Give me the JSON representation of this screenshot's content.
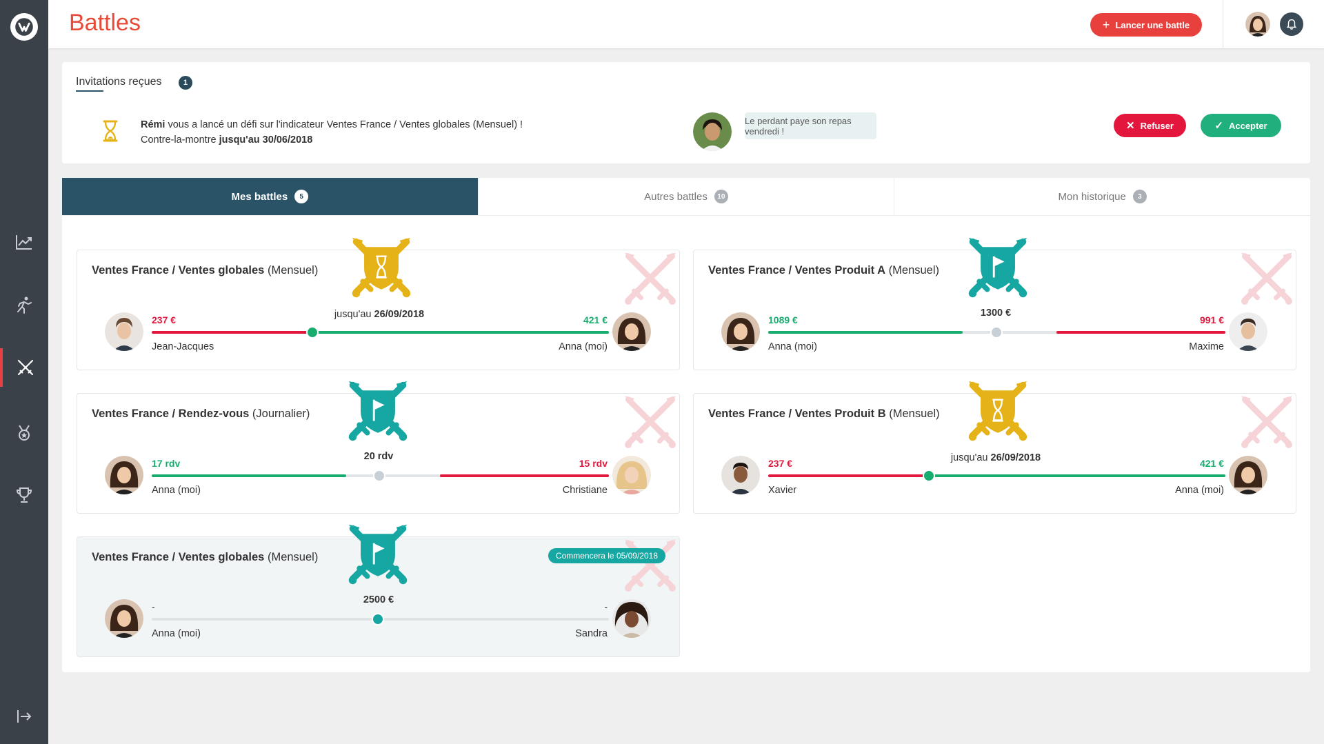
{
  "app": {
    "title": "Battles"
  },
  "header": {
    "launch_label": "Lancer une battle"
  },
  "sidebar": {
    "items": [
      {
        "name": "stats",
        "icon": "chart-line-icon"
      },
      {
        "name": "challenge",
        "icon": "runner-icon"
      },
      {
        "name": "battles",
        "icon": "crossed-swords-icon",
        "active": true
      },
      {
        "name": "badges",
        "icon": "medal-icon"
      },
      {
        "name": "trophies",
        "icon": "trophy-icon"
      },
      {
        "name": "logout",
        "icon": "logout-icon"
      }
    ]
  },
  "invitations": {
    "title": "Invitations reçues",
    "count": "1",
    "sender": "Rémi",
    "text_1": " vous a lancé un défi sur l'indicateur Ventes France / Ventes globales (Mensuel) !",
    "text_2": "Contre-la-montre ",
    "deadline": "jusqu'au 30/06/2018",
    "message": "Le perdant paye son repas vendredi !",
    "refuse_label": "Refuser",
    "accept_label": "Accepter"
  },
  "tabs": [
    {
      "label": "Mes battles",
      "count": "5",
      "active": true
    },
    {
      "label": "Autres battles",
      "count": "10",
      "active": false
    },
    {
      "label": "Mon historique",
      "count": "3",
      "active": false
    }
  ],
  "battles": [
    {
      "title_bold": "Ventes France / Ventes globales",
      "title_rest": " (Mensuel)",
      "badge": "hourglass",
      "goal_prefix": "jusqu'au ",
      "goal": "26/09/2018",
      "left_value": "237 €",
      "left_name": "Jean-Jacques",
      "right_value": "421 €",
      "right_name": "Anna (moi)",
      "progress": 0.36
    },
    {
      "title_bold": "Ventes France / Ventes Produit A",
      "title_rest": " (Mensuel)",
      "badge": "flag",
      "goal_prefix": "",
      "goal": "1300 €",
      "left_value": "1089 €",
      "left_name": "Anna (moi)",
      "right_value": "991 €",
      "right_name": "Maxime"
    },
    {
      "title_bold": "Ventes France / Rendez-vous",
      "title_rest": " (Journalier)",
      "badge": "flag",
      "goal_prefix": "",
      "goal": "20 rdv",
      "left_value": "17 rdv",
      "left_name": "Anna (moi)",
      "right_value": "15 rdv",
      "right_name": "Christiane"
    },
    {
      "title_bold": "Ventes France / Ventes Produit B",
      "title_rest": " (Mensuel)",
      "badge": "hourglass",
      "goal_prefix": "jusqu'au ",
      "goal": "26/09/2018",
      "left_value": "237 €",
      "left_name": "Xavier",
      "right_value": "421 €",
      "right_name": "Anna (moi)",
      "progress": 0.36
    },
    {
      "title_bold": "Ventes France / Ventes globales",
      "title_rest": " (Mensuel)",
      "badge": "flag",
      "goal_prefix": "",
      "goal": "2500 €",
      "left_value": "-",
      "left_name": "Anna (moi)",
      "right_value": "-",
      "right_name": "Sandra",
      "start_label": "Commencera le 05/09/2018"
    }
  ],
  "colors": {
    "accent_red": "#e3173e",
    "accent_green": "#17ad6e",
    "badge_gold": "#e5b217",
    "badge_teal": "#17a7a2",
    "tab_active": "#2b5368"
  }
}
